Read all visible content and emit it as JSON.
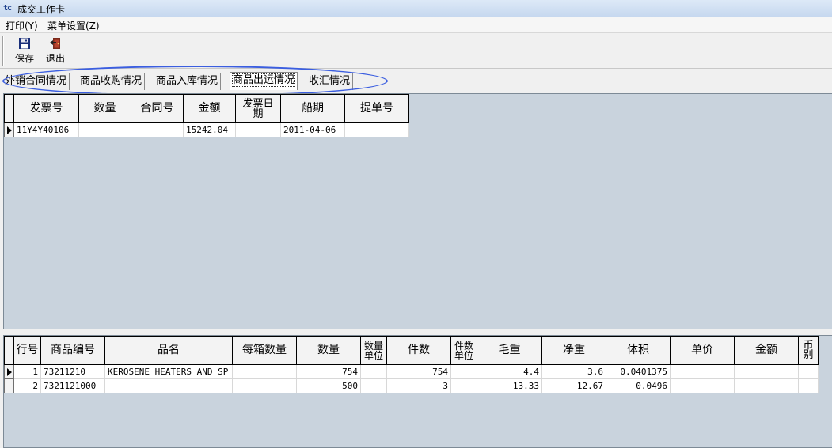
{
  "window": {
    "title": "成交工作卡",
    "app_icon_glyph": "tc"
  },
  "menu": {
    "items": [
      "打印(Y)",
      "菜单设置(Z)"
    ]
  },
  "toolbar": {
    "save_label": "保存",
    "save_icon": "floppy-disk-icon",
    "exit_label": "退出",
    "exit_icon": "exit-door-icon"
  },
  "tabs": {
    "items": [
      "外销合同情况",
      "商品收购情况",
      "商品入库情况",
      "商品出运情况",
      "收汇情况"
    ],
    "active_index": 3
  },
  "invoice_grid": {
    "columns": [
      "发票号",
      "数量",
      "合同号",
      "金额",
      "发票日期",
      "船期",
      "提单号"
    ],
    "rows": [
      {
        "发票号": "11Y4Y40106",
        "数量": "",
        "合同号": "",
        "金额": "15242.04",
        "发票日期": "",
        "船期": "2011-04-06",
        "提单号": ""
      }
    ]
  },
  "goods_grid": {
    "columns": [
      "行号",
      "商品编号",
      "品名",
      "每箱数量",
      "数量",
      "数量单位",
      "件数",
      "件数单位",
      "毛重",
      "净重",
      "体积",
      "单价",
      "金额",
      "币别"
    ],
    "rows": [
      {
        "行号": "1",
        "商品编号": "73211210",
        "品名": "KEROSENE HEATERS AND SP",
        "每箱数量": "",
        "数量": "754",
        "数量单位": "",
        "件数": "754",
        "件数单位": "",
        "毛重": "4.4",
        "净重": "3.6",
        "体积": "0.0401375",
        "单价": "",
        "金额": "",
        "币别": ""
      },
      {
        "行号": "2",
        "商品编号": "7321121000",
        "品名": "",
        "每箱数量": "",
        "数量": "500",
        "数量单位": "",
        "件数": "3",
        "件数单位": "",
        "毛重": "13.33",
        "净重": "12.67",
        "体积": "0.0496",
        "单价": "",
        "金额": "",
        "币别": ""
      }
    ]
  },
  "colors": {
    "grid_background": "#c9d3dd",
    "annotation_ellipse": "#3b5ee0",
    "titlebar": "#c6d8ef"
  }
}
